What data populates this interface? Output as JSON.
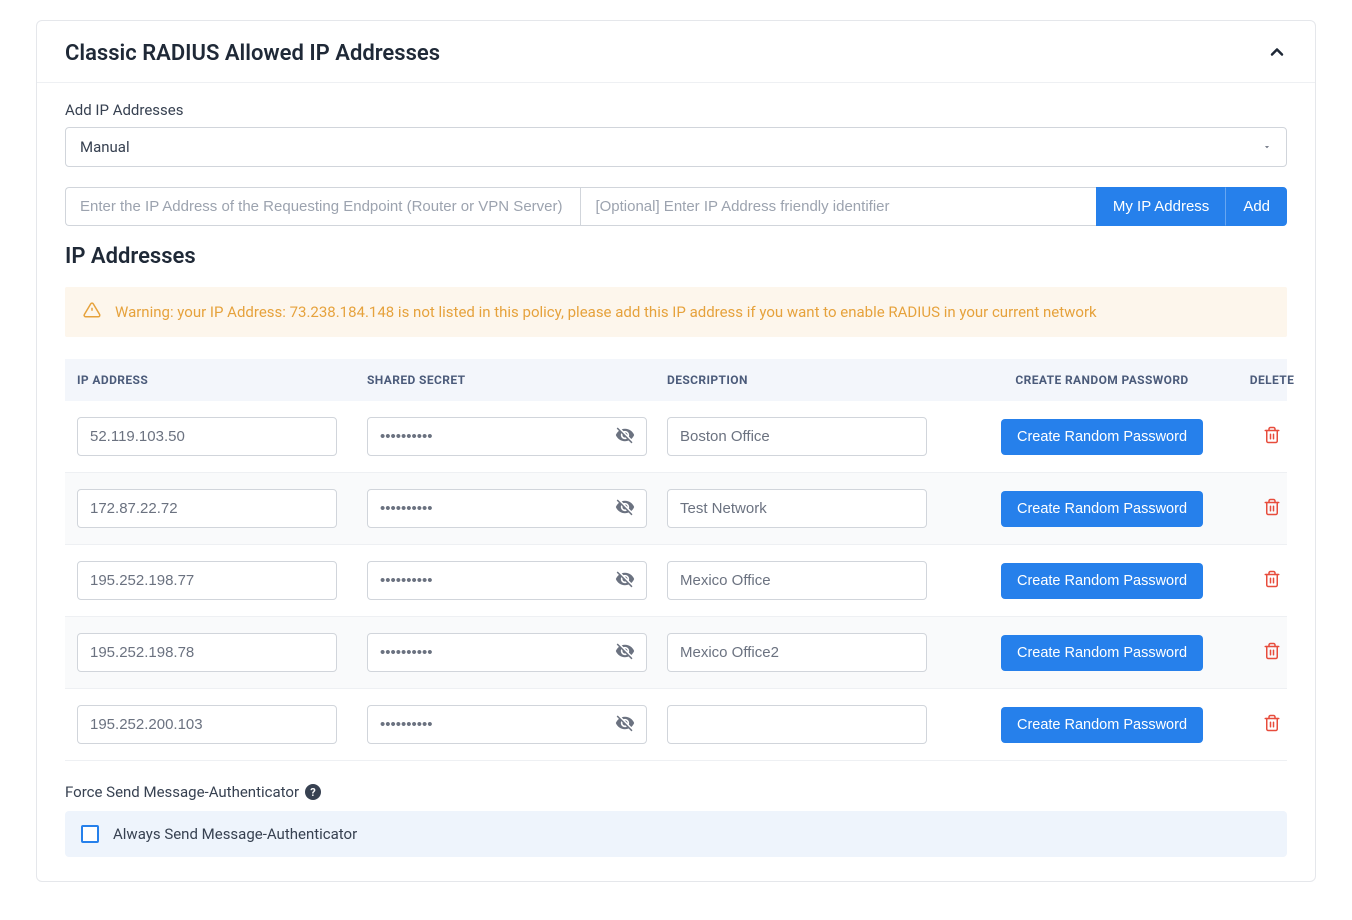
{
  "panel": {
    "title": "Classic RADIUS Allowed IP Addresses"
  },
  "addSection": {
    "label": "Add IP Addresses",
    "modeSelected": "Manual",
    "ipPlaceholder": "Enter the IP Address of the Requesting Endpoint (Router or VPN Server)",
    "friendlyPlaceholder": "[Optional] Enter IP Address friendly identifier",
    "myIpBtn": "My IP Address",
    "addBtn": "Add"
  },
  "listSection": {
    "title": "IP Addresses",
    "warning": "Warning: your IP Address: 73.238.184.148 is not listed in this policy, please add this IP address if you want to enable RADIUS in your current network"
  },
  "table": {
    "headers": {
      "ip": "IP ADDRESS",
      "secret": "SHARED SECRET",
      "desc": "DESCRIPTION",
      "create": "CREATE RANDOM PASSWORD",
      "delete": "DELETE"
    },
    "randomBtn": "Create Random Password",
    "rows": [
      {
        "ip": "52.119.103.50",
        "secret": "••••••••••",
        "desc": "Boston Office"
      },
      {
        "ip": "172.87.22.72",
        "secret": "••••••••••",
        "desc": "Test Network"
      },
      {
        "ip": "195.252.198.77",
        "secret": "••••••••••",
        "desc": "Mexico Office"
      },
      {
        "ip": "195.252.198.78",
        "secret": "••••••••••",
        "desc": "Mexico Office2"
      },
      {
        "ip": "195.252.200.103",
        "secret": "••••••••••",
        "desc": ""
      }
    ]
  },
  "authenticator": {
    "label": "Force Send Message-Authenticator",
    "checkboxLabel": "Always Send Message-Authenticator"
  }
}
